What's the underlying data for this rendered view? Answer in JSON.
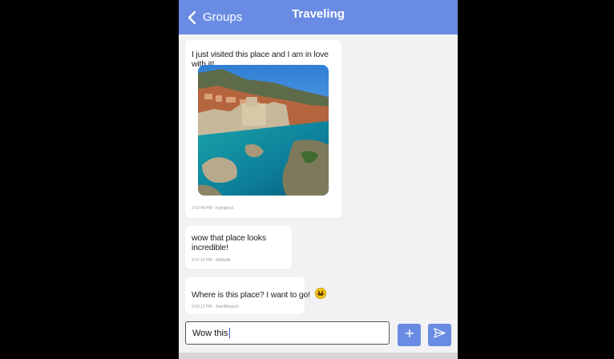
{
  "header": {
    "back_label": "Groups",
    "title": "Traveling"
  },
  "messages": [
    {
      "text": "I just visited this place and I am in love with it!",
      "meta": "2:43:46 PM - hydrghost",
      "has_image": true
    },
    {
      "text": "wow that place looks incredible!",
      "meta": "2:47:10 PM - Wildulife",
      "has_image": false
    },
    {
      "text": "Where is this place? I want to go!",
      "meta": "2:50:12 PM - JoanBlaqock",
      "emoji": "grinning-face"
    }
  ],
  "composer": {
    "value": "Wow this "
  },
  "colors": {
    "accent": "#6a8be3",
    "background": "#f2f2f4"
  },
  "icons": {
    "back": "chevron-left-icon",
    "add": "plus-icon",
    "send": "send-icon"
  }
}
